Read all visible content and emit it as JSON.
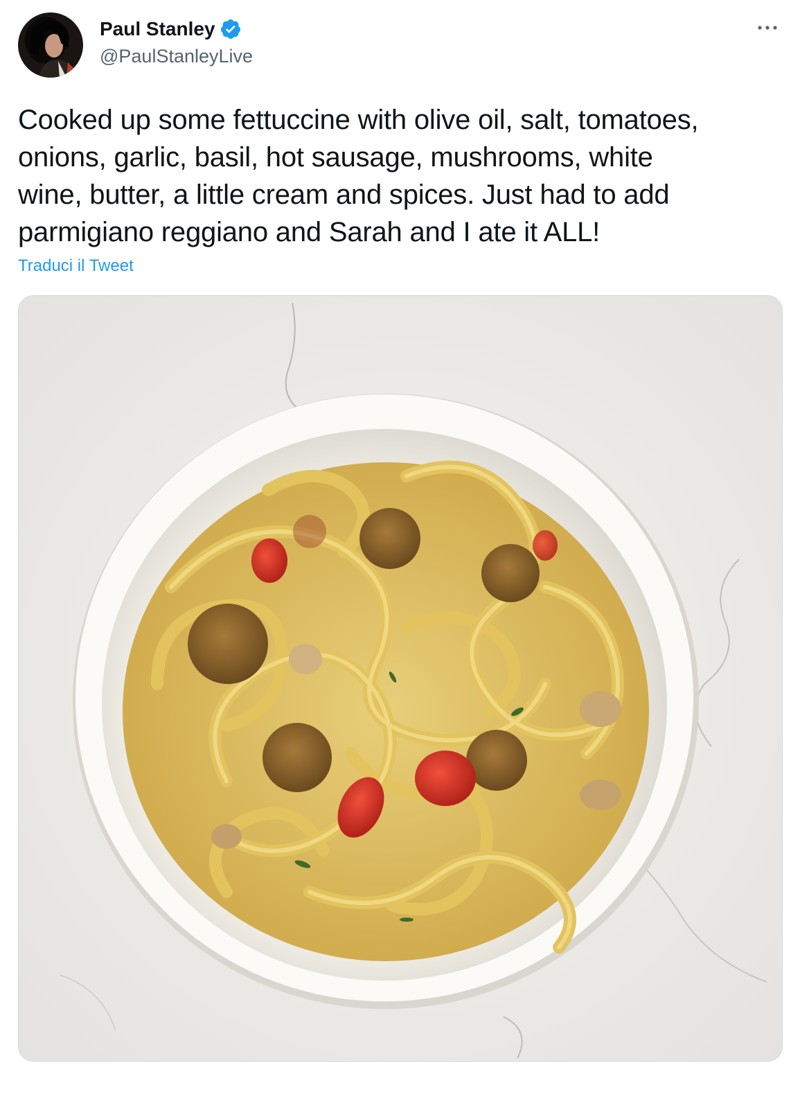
{
  "tweet": {
    "author": {
      "display_name": "Paul Stanley",
      "handle": "@PaulStanleyLive",
      "verified": true,
      "avatar_icon": "profile-photo"
    },
    "text": "Cooked up some fettuccine with olive oil, salt, tomatoes,\nonions, garlic, basil, hot sausage, mushrooms, white\nwine, butter, a little cream and spices. Just had to add\nparmigiano reggiano and Sarah and I ate it ALL!",
    "translate_label": "Traduci il Tweet",
    "more_icon": "more-horizontal-icon",
    "media": {
      "type": "photo",
      "icon": "photo"
    }
  },
  "colors": {
    "link": "#1d9bf0",
    "verified": "#1d9bf0",
    "secondary_text": "#536471",
    "primary_text": "#0f1419",
    "border": "#cfd9de"
  }
}
